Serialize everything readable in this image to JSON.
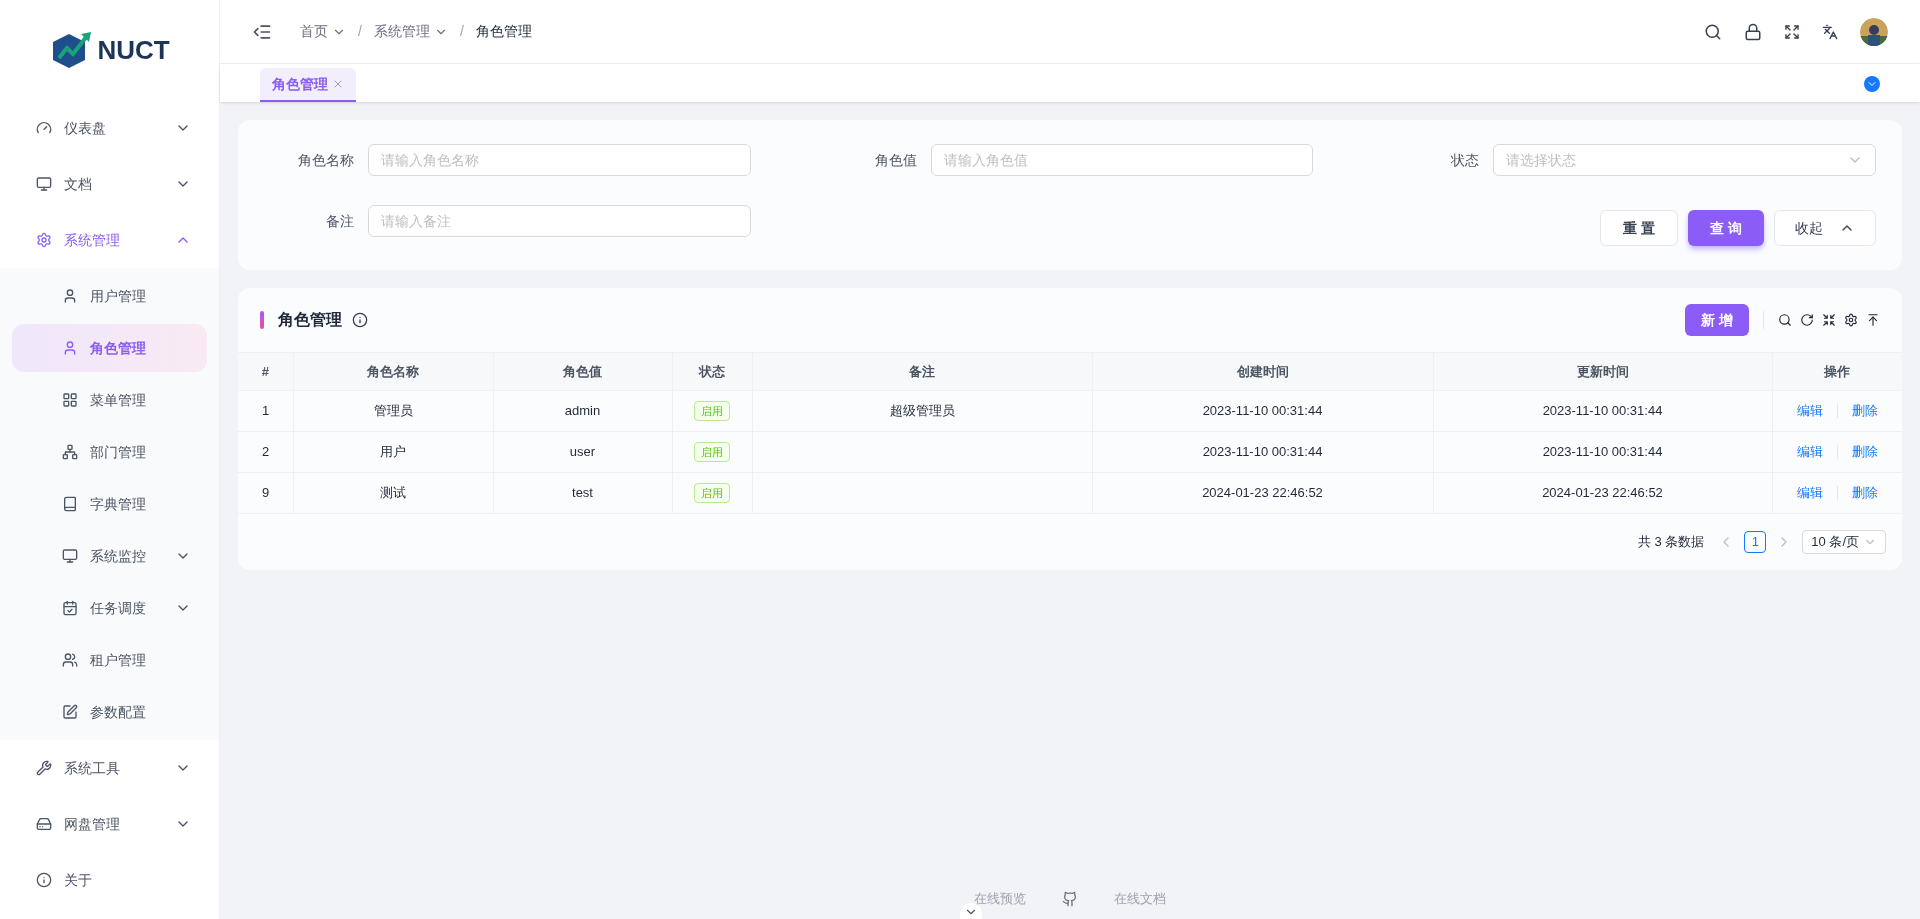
{
  "logo": {
    "text": "NUCT"
  },
  "sidebar": {
    "items": [
      {
        "label": "仪表盘",
        "selected": false,
        "expanded": false
      },
      {
        "label": "文档",
        "selected": false,
        "expanded": false
      },
      {
        "label": "系统管理",
        "selected": true,
        "expanded": true,
        "children": [
          {
            "label": "用户管理",
            "selected": false
          },
          {
            "label": "角色管理",
            "selected": true
          },
          {
            "label": "菜单管理",
            "selected": false
          },
          {
            "label": "部门管理",
            "selected": false
          },
          {
            "label": "字典管理",
            "selected": false
          },
          {
            "label": "系统监控",
            "selected": false,
            "expanded": false
          },
          {
            "label": "任务调度",
            "selected": false,
            "expanded": false
          },
          {
            "label": "租户管理",
            "selected": false
          },
          {
            "label": "参数配置",
            "selected": false
          }
        ]
      },
      {
        "label": "系统工具",
        "selected": false,
        "expanded": false
      },
      {
        "label": "网盘管理",
        "selected": false,
        "expanded": false
      },
      {
        "label": "关于",
        "selected": false
      }
    ]
  },
  "breadcrumb_separator": "/",
  "breadcrumb": [
    {
      "label": "首页",
      "dropdown": true
    },
    {
      "label": "系统管理",
      "dropdown": true
    },
    {
      "label": "角色管理",
      "dropdown": false
    }
  ],
  "tabs": [
    {
      "label": "角色管理",
      "selected": true
    }
  ],
  "search_form": {
    "fields": [
      {
        "label": "角色名称",
        "placeholder": "请输入角色名称",
        "kind": "input"
      },
      {
        "label": "角色值",
        "placeholder": "请输入角色值",
        "kind": "input"
      },
      {
        "label": "状态",
        "placeholder": "请选择状态",
        "kind": "select"
      },
      {
        "label": "备注",
        "placeholder": "请输入备注",
        "kind": "input"
      }
    ],
    "buttons": [
      {
        "label": "重 置",
        "kind": "default"
      },
      {
        "label": "查 询",
        "kind": "primary"
      },
      {
        "label": "收起",
        "kind": "collapse"
      }
    ]
  },
  "table": {
    "title": "角色管理",
    "add_button": "新 增",
    "columns": [
      "#",
      "角色名称",
      "角色值",
      "状态",
      "备注",
      "创建时间",
      "更新时间",
      "操作"
    ],
    "rows": [
      {
        "cells": [
          "1",
          "管理员",
          "admin",
          "启用",
          "超级管理员",
          "2023-11-10 00:31:44",
          "2023-11-10 00:31:44"
        ],
        "actions": [
          "编辑",
          "删除"
        ]
      },
      {
        "cells": [
          "2",
          "用户",
          "user",
          "启用",
          "",
          "2023-11-10 00:31:44",
          "2023-11-10 00:31:44"
        ],
        "actions": [
          "编辑",
          "删除"
        ]
      },
      {
        "cells": [
          "9",
          "测试",
          "test",
          "启用",
          "",
          "2024-01-23 22:46:52",
          "2024-01-23 22:46:52"
        ],
        "actions": [
          "编辑",
          "删除"
        ]
      }
    ]
  },
  "pagination": {
    "total": "共 3 条数据",
    "pages": [
      {
        "label": "1",
        "selected": true
      }
    ],
    "page_size": "10 条/页"
  },
  "footer": {
    "links": [
      {
        "label": "在线预览",
        "kind": "text"
      },
      {
        "kind": "github"
      },
      {
        "label": "在线文档",
        "kind": "text"
      }
    ]
  }
}
